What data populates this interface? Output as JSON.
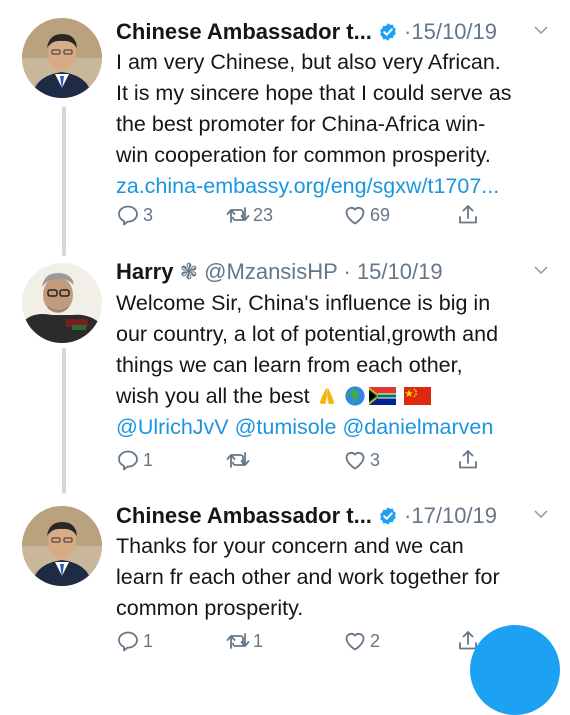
{
  "colors": {
    "link": "#1b95e0",
    "verified": "#1da1f2",
    "muted": "#657786"
  },
  "tweets": [
    {
      "name": "Chinese Ambassador t...",
      "verified": true,
      "handle": "",
      "sep": "·",
      "date": "15/10/19",
      "text_lines": [
        "I am very Chinese, but also very African.",
        "It is my sincere hope that I could serve as",
        "the best promoter for China-Africa win-",
        "win cooperation for common prosperity."
      ],
      "link": "za.china-embassy.org/eng/sgxw/t1707...",
      "replies": "3",
      "retweets": "23",
      "likes": "69"
    },
    {
      "name": "Harry",
      "name_symbol": "❃",
      "verified": false,
      "handle": "@MzansisHP",
      "sep": "·",
      "date": "15/10/19",
      "text_lines": [
        "Welcome Sir, China's influence is big in",
        "our country, a lot of potential,growth and",
        "things we can learn from each other,",
        "wish you all the best"
      ],
      "emoji": [
        "folded-hands",
        "globe-africa",
        "flag-south-africa",
        "flag-china"
      ],
      "mentions": "@UlrichJvV @tumisole @danielmarven",
      "replies": "1",
      "retweets": "",
      "likes": "3"
    },
    {
      "name": "Chinese Ambassador t...",
      "verified": true,
      "handle": "",
      "sep": "·",
      "date": "17/10/19",
      "text_lines": [
        "Thanks for your concern and we can",
        "learn fr each other and work together for",
        "common prosperity."
      ],
      "replies": "1",
      "retweets": "1",
      "likes": "2"
    }
  ]
}
